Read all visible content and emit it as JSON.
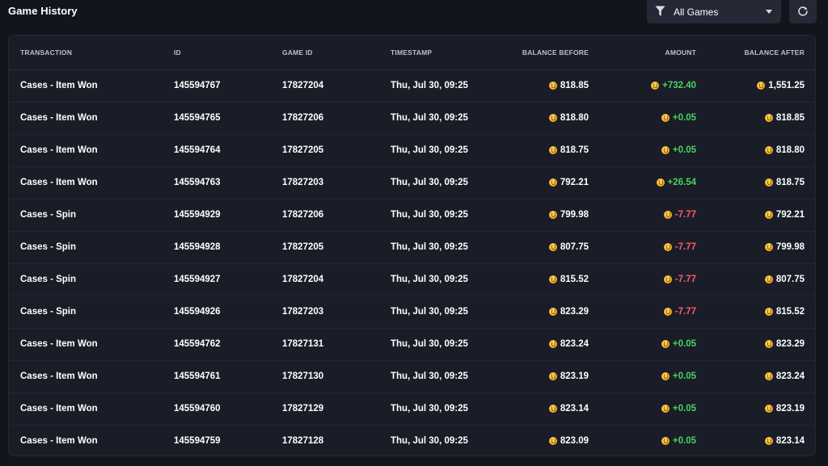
{
  "header": {
    "title": "Game History",
    "filter": {
      "selected": "All Games"
    }
  },
  "colors": {
    "positive": "#48d35f",
    "negative": "#ff5a67",
    "coin": "#f3b523"
  },
  "icons": {
    "filter": "filter-icon",
    "dropdown": "chevron-down-icon",
    "refresh": "refresh-icon",
    "currency": "coin-icon"
  },
  "table": {
    "columns": [
      "TRANSACTION",
      "ID",
      "GAME ID",
      "TIMESTAMP",
      "BALANCE BEFORE",
      "AMOUNT",
      "BALANCE AFTER"
    ],
    "rows": [
      {
        "transaction": "Cases - Item Won",
        "id": "145594767",
        "game_id": "17827204",
        "timestamp": "Thu, Jul 30, 09:25",
        "balance_before": "818.85",
        "amount": "+732.40",
        "amount_sign": "pos",
        "balance_after": "1,551.25"
      },
      {
        "transaction": "Cases - Item Won",
        "id": "145594765",
        "game_id": "17827206",
        "timestamp": "Thu, Jul 30, 09:25",
        "balance_before": "818.80",
        "amount": "+0.05",
        "amount_sign": "pos",
        "balance_after": "818.85"
      },
      {
        "transaction": "Cases - Item Won",
        "id": "145594764",
        "game_id": "17827205",
        "timestamp": "Thu, Jul 30, 09:25",
        "balance_before": "818.75",
        "amount": "+0.05",
        "amount_sign": "pos",
        "balance_after": "818.80"
      },
      {
        "transaction": "Cases - Item Won",
        "id": "145594763",
        "game_id": "17827203",
        "timestamp": "Thu, Jul 30, 09:25",
        "balance_before": "792.21",
        "amount": "+26.54",
        "amount_sign": "pos",
        "balance_after": "818.75"
      },
      {
        "transaction": "Cases - Spin",
        "id": "145594929",
        "game_id": "17827206",
        "timestamp": "Thu, Jul 30, 09:25",
        "balance_before": "799.98",
        "amount": "-7.77",
        "amount_sign": "neg",
        "balance_after": "792.21"
      },
      {
        "transaction": "Cases - Spin",
        "id": "145594928",
        "game_id": "17827205",
        "timestamp": "Thu, Jul 30, 09:25",
        "balance_before": "807.75",
        "amount": "-7.77",
        "amount_sign": "neg",
        "balance_after": "799.98"
      },
      {
        "transaction": "Cases - Spin",
        "id": "145594927",
        "game_id": "17827204",
        "timestamp": "Thu, Jul 30, 09:25",
        "balance_before": "815.52",
        "amount": "-7.77",
        "amount_sign": "neg",
        "balance_after": "807.75"
      },
      {
        "transaction": "Cases - Spin",
        "id": "145594926",
        "game_id": "17827203",
        "timestamp": "Thu, Jul 30, 09:25",
        "balance_before": "823.29",
        "amount": "-7.77",
        "amount_sign": "neg",
        "balance_after": "815.52"
      },
      {
        "transaction": "Cases - Item Won",
        "id": "145594762",
        "game_id": "17827131",
        "timestamp": "Thu, Jul 30, 09:25",
        "balance_before": "823.24",
        "amount": "+0.05",
        "amount_sign": "pos",
        "balance_after": "823.29"
      },
      {
        "transaction": "Cases - Item Won",
        "id": "145594761",
        "game_id": "17827130",
        "timestamp": "Thu, Jul 30, 09:25",
        "balance_before": "823.19",
        "amount": "+0.05",
        "amount_sign": "pos",
        "balance_after": "823.24"
      },
      {
        "transaction": "Cases - Item Won",
        "id": "145594760",
        "game_id": "17827129",
        "timestamp": "Thu, Jul 30, 09:25",
        "balance_before": "823.14",
        "amount": "+0.05",
        "amount_sign": "pos",
        "balance_after": "823.19"
      },
      {
        "transaction": "Cases - Item Won",
        "id": "145594759",
        "game_id": "17827128",
        "timestamp": "Thu, Jul 30, 09:25",
        "balance_before": "823.09",
        "amount": "+0.05",
        "amount_sign": "pos",
        "balance_after": "823.14"
      }
    ]
  }
}
